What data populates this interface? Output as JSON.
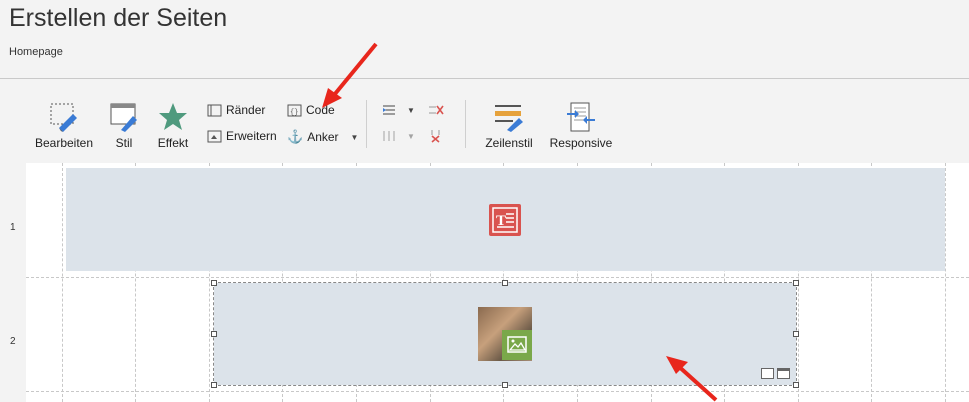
{
  "header": {
    "title": "Erstellen der Seiten",
    "breadcrumb": "Homepage"
  },
  "toolbar": {
    "edit_label": "Bearbeiten",
    "style_label": "Stil",
    "effect_label": "Effekt",
    "borders_label": "Ränder",
    "extend_label": "Erweitern",
    "code_label": "Code",
    "anchor_label": "Anker",
    "row_style_label": "Zeilenstil",
    "responsive_label": "Responsive"
  },
  "grid": {
    "rows": [
      "1",
      "2"
    ]
  },
  "colors": {
    "accent_red": "#e8261c",
    "text_widget": "#d9534f",
    "image_badge": "#7aa84a",
    "block_bg": "#dce3ea"
  }
}
